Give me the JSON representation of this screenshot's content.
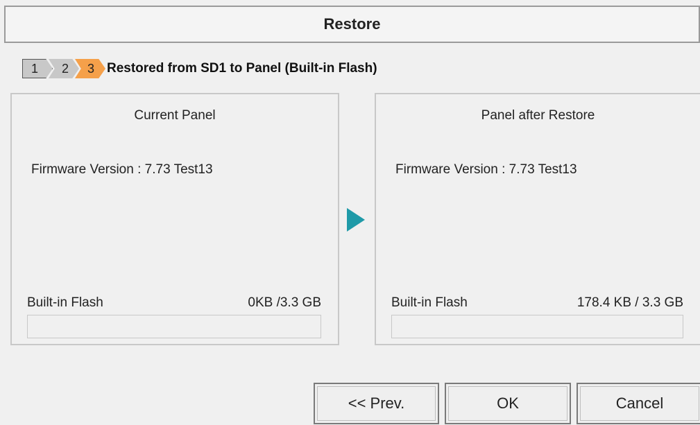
{
  "dialog": {
    "title": "Restore"
  },
  "steps": {
    "items": [
      "1",
      "2",
      "3"
    ],
    "current_label": "Restored from SD1 to Panel (Built-in Flash)"
  },
  "current_panel": {
    "title": "Current Panel",
    "firmware_label": "Firmware Version :",
    "firmware_value": "7.73 Test13",
    "storage_label": "Built-in Flash",
    "storage_value": "0KB /3.3 GB",
    "usage_fraction": 0
  },
  "after_panel": {
    "title": "Panel after Restore",
    "firmware_label": "Firmware Version :",
    "firmware_value": "7.73 Test13",
    "storage_label": "Built-in Flash",
    "storage_value": "178.4 KB / 3.3 GB",
    "usage_fraction": 0
  },
  "buttons": {
    "prev": "<< Prev.",
    "ok": "OK",
    "cancel": "Cancel"
  },
  "colors": {
    "accent_step": "#f5a04a",
    "arrow": "#1f9aa8"
  }
}
